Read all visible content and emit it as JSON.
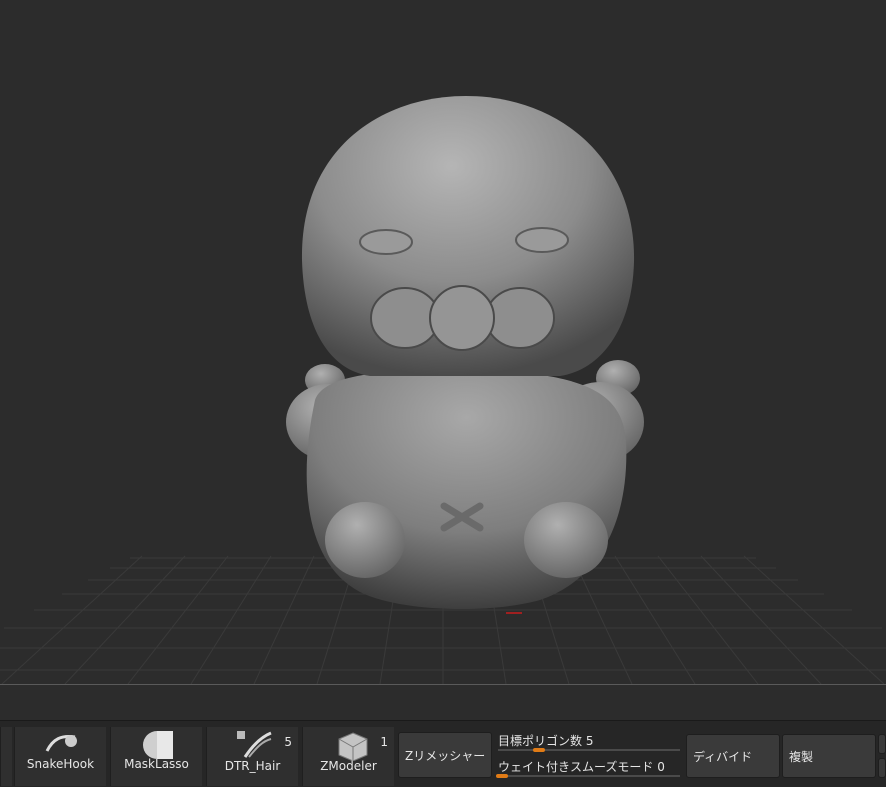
{
  "shelf": {
    "brushes": [
      {
        "label": "SnakeHook",
        "icon": "snakehook-brush-icon",
        "count": ""
      },
      {
        "label": "MaskLasso",
        "icon": "masklasso-brush-icon",
        "count": ""
      },
      {
        "label": "DTR_Hair",
        "icon": "dtr-hair-brush-icon",
        "count": "5"
      },
      {
        "label": "ZModeler",
        "icon": "zmodeler-brush-icon",
        "count": "1"
      }
    ],
    "zremesher_label": "Zリメッシャー",
    "target_polygons": {
      "label": "目標ポリゴン数",
      "value": "5"
    },
    "weighted_smooth": {
      "label": "ウェイト付きスムーズモード",
      "value": "0"
    },
    "divide_label": "ディバイド",
    "duplicate_label": "複製"
  },
  "colors": {
    "accent": "#e07b16",
    "viewport_bg": "#2c2c2c",
    "model": "#8a8a8a"
  }
}
